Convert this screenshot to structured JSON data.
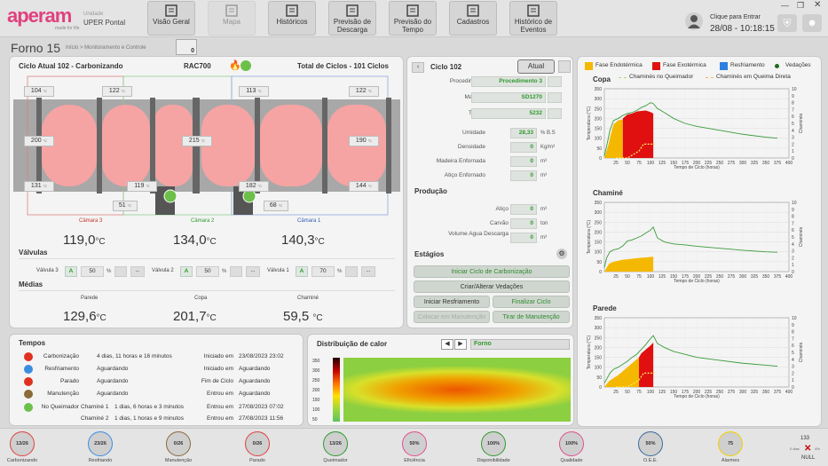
{
  "brand": {
    "logo": "aperam",
    "tagline": "made for life",
    "unit_label": "Unidade",
    "unit_name": "UPER Pontal"
  },
  "nav": [
    {
      "label": "Visão Geral",
      "icon": "grid-icon",
      "enabled": true
    },
    {
      "label": "Mapa",
      "icon": "map-icon",
      "enabled": false
    },
    {
      "label": "Históricos",
      "icon": "document-icon",
      "enabled": true
    },
    {
      "label": "Previsão de Descarga",
      "icon": "calendar-icon",
      "enabled": true
    },
    {
      "label": "Previsão do Tempo",
      "icon": "weather-icon",
      "enabled": true
    },
    {
      "label": "Cadastros",
      "icon": "register-icon",
      "enabled": true
    },
    {
      "label": "Histórico de Eventos",
      "icon": "document-icon",
      "enabled": true
    }
  ],
  "login": {
    "label": "Clique para Entrar",
    "datetime": "28/08 - 10:18:15"
  },
  "page": {
    "title": "Forno 15",
    "breadcrumb": "Início > Monitoramento e Controle",
    "alarm_count": "0"
  },
  "furnace": {
    "cycle_title": "Ciclo Atual 102 - Carbonizando",
    "rac": "RAC700",
    "total_cycles": "Total de Ciclos - 101 Ciclos",
    "temps_top": [
      "104",
      "122",
      "113",
      "122"
    ],
    "temps_mid": [
      "200",
      "215",
      "190"
    ],
    "temps_bottom": [
      "131",
      "119",
      "182",
      "144"
    ],
    "temps_lower": [
      "51",
      "68"
    ],
    "deg": "°C",
    "chambers": [
      {
        "name": "Câmara 3",
        "color": "#c0392b",
        "value": "119,0",
        "unit": "°C"
      },
      {
        "name": "Câmara 2",
        "color": "#2e9a2e",
        "value": "134,0",
        "unit": "°C"
      },
      {
        "name": "Câmara 1",
        "color": "#2f5fb5",
        "value": "140,3",
        "unit": "°C"
      }
    ],
    "valves_title": "Válvulas",
    "valves": [
      {
        "label": "Válvula 3",
        "mode": "A",
        "value": "50",
        "unit": "%",
        "dots": "..."
      },
      {
        "label": "Válvula 2",
        "mode": "A",
        "value": "50",
        "unit": "%",
        "dots": "..."
      },
      {
        "label": "Válvula 1",
        "mode": "A",
        "value": "70",
        "unit": "%",
        "dots": "..."
      }
    ],
    "medias_title": "Médias",
    "medias": [
      {
        "label": "Parede",
        "value": "129,6",
        "unit": "°C"
      },
      {
        "label": "Copa",
        "value": "201,7",
        "unit": "°C"
      },
      {
        "label": "Chaminé",
        "value": "59,5",
        "unit": "°C"
      }
    ]
  },
  "cycle": {
    "title": "Ciclo 102",
    "current_btn": "Atual",
    "fields": [
      {
        "label": "Procedimento",
        "value": "Procedimento 3",
        "unit": ""
      },
      {
        "label": "Madeira",
        "value": "SD1270",
        "unit": ""
      },
      {
        "label": "Talhão",
        "value": "5232",
        "unit": ""
      },
      {
        "label": "Umidade",
        "value": "28,33",
        "unit": "% B.S"
      },
      {
        "label": "Densidade",
        "value": "0",
        "unit": "Kg/m³"
      },
      {
        "label": "Madeira Enfornada",
        "value": "0",
        "unit": "m³"
      },
      {
        "label": "Atiço Enfornado",
        "value": "0",
        "unit": "m³"
      }
    ],
    "production_title": "Produção",
    "production": [
      {
        "label": "Atiço",
        "value": "0",
        "unit": "m³"
      },
      {
        "label": "Carvão",
        "value": "0",
        "unit": "ton"
      },
      {
        "label": "Volume Agua Descarga",
        "value": "0",
        "unit": "m³"
      }
    ],
    "stages_title": "Estágios",
    "stages": {
      "start": "Iniciar Ciclo de Carbonização",
      "seal": "Criar/Alterar Vedações",
      "cool": "Iniciar Resfriamento",
      "finish": "Finalizar Ciclo",
      "maint_off": "Colocar em Manutenção",
      "maint_on": "Tirar de Manutenção"
    }
  },
  "times": {
    "title": "Tempos",
    "rows": [
      {
        "icon": "flame-icon",
        "label": "Carbonização",
        "value": "4 dias, 11 horas e 16 minutos",
        "k": "Iniciado em",
        "v": "23/08/2023 23:02"
      },
      {
        "icon": "snowflake-icon",
        "label": "Resfriamento",
        "value": "Aguardando",
        "k": "Iniciado em",
        "v": "Aguardando"
      },
      {
        "icon": "stop-icon",
        "label": "Parado",
        "value": "Aguardando",
        "k": "Fim de Ciclo",
        "v": "Aguardando"
      },
      {
        "icon": "tools-icon",
        "label": "Manutenção",
        "value": "Aguardando",
        "k": "Entrou em",
        "v": "Aguardando"
      }
    ],
    "burner_label": "No Queimador",
    "burner": [
      {
        "label": "Chaminé 1",
        "value": "1 dias, 6 horas e 3 minutos",
        "k": "Entrou em",
        "v": "27/08/2023 07:02"
      },
      {
        "label": "Chaminé 2",
        "value": "1 dias, 1 horas e 9 minutos",
        "k": "Entrou em",
        "v": "27/08/2023 11:56"
      }
    ]
  },
  "heat": {
    "title": "Distribuição de calor",
    "selector": "Forno",
    "scale": [
      "350",
      "300",
      "250",
      "200",
      "150",
      "100",
      "50"
    ]
  },
  "legend": [
    {
      "label": "Fase Endotérmica",
      "color": "#f5b800"
    },
    {
      "label": "Fase Exotérmica",
      "color": "#e01010"
    },
    {
      "label": "Resfriamento",
      "color": "#2d7fe0"
    },
    {
      "label": "Vedações",
      "color": "#1f6b1f"
    },
    {
      "label": "Chaminés no Queimador",
      "color": "#a6e36b"
    },
    {
      "label": "Chaminés em Queima Direta",
      "color": "#f0b060"
    }
  ],
  "chart_data": [
    {
      "type": "area",
      "title": "Copa",
      "xlabel": "Tempo de Ciclo (horas)",
      "ylabel": "Temperatura (°C)",
      "y2label": "Chaminés",
      "xlim": [
        0,
        400
      ],
      "ylim": [
        0,
        350
      ],
      "y2lim": [
        0,
        10
      ],
      "xticks": [
        "25",
        "50",
        "75",
        "100",
        "125",
        "150",
        "175",
        "200",
        "225",
        "250",
        "275",
        "300",
        "325",
        "350",
        "375",
        "400"
      ],
      "yticks": [
        "0",
        "50",
        "100",
        "150",
        "200",
        "250",
        "300",
        "350"
      ],
      "y2ticks": [
        "0",
        "1",
        "2",
        "3",
        "4",
        "5",
        "6",
        "7",
        "8",
        "9",
        "10"
      ],
      "series": [
        {
          "name": "Temperatura",
          "x": [
            0,
            5,
            12,
            20,
            30,
            40,
            50,
            60,
            70,
            80,
            90,
            100,
            106,
            115,
            130,
            150,
            175,
            200,
            250,
            300,
            350,
            375
          ],
          "y": [
            10,
            60,
            140,
            190,
            200,
            215,
            225,
            230,
            240,
            255,
            265,
            280,
            275,
            250,
            230,
            200,
            175,
            160,
            140,
            120,
            105,
            100
          ]
        },
        {
          "name": "Fase Endotérmica",
          "x": [
            0,
            8,
            14,
            20,
            30,
            40
          ],
          "y": [
            0,
            60,
            120,
            170,
            190,
            195
          ]
        },
        {
          "name": "Fase Exotérmica",
          "x": [
            40,
            50,
            60,
            70,
            80,
            90,
            100,
            106
          ],
          "y": [
            200,
            220,
            225,
            235,
            238,
            240,
            232,
            225
          ]
        },
        {
          "name": "Chaminés no Queimador",
          "x": [
            25,
            50,
            75,
            85,
            100,
            110
          ],
          "y": [
            0,
            0,
            1,
            2,
            2,
            2
          ]
        }
      ]
    },
    {
      "type": "area",
      "title": "Chaminé",
      "xlabel": "Tempo de Ciclo (horas)",
      "ylabel": "Temperatura (°C)",
      "y2label": "Chaminés",
      "xlim": [
        0,
        400
      ],
      "ylim": [
        0,
        350
      ],
      "y2lim": [
        0,
        10
      ],
      "xticks": [
        "25",
        "50",
        "75",
        "100",
        "125",
        "150",
        "175",
        "200",
        "225",
        "250",
        "275",
        "300",
        "325",
        "350",
        "375",
        "400"
      ],
      "yticks": [
        "0",
        "50",
        "100",
        "150",
        "200",
        "250",
        "300",
        "350"
      ],
      "y2ticks": [
        "0",
        "1",
        "2",
        "3",
        "4",
        "5",
        "6",
        "7",
        "8",
        "9",
        "10"
      ],
      "series": [
        {
          "name": "Temperatura",
          "x": [
            0,
            5,
            12,
            20,
            30,
            40,
            50,
            60,
            70,
            80,
            90,
            100,
            106,
            115,
            130,
            150,
            175,
            200,
            250,
            300,
            350,
            375
          ],
          "y": [
            20,
            70,
            100,
            110,
            115,
            130,
            155,
            160,
            170,
            180,
            195,
            210,
            225,
            170,
            150,
            140,
            135,
            128,
            118,
            108,
            100,
            98
          ]
        },
        {
          "name": "Fase Endotérmica",
          "x": [
            0,
            10,
            20,
            30,
            40,
            50,
            60,
            70,
            80,
            90,
            100,
            106
          ],
          "y": [
            0,
            40,
            50,
            55,
            60,
            62,
            65,
            68,
            70,
            72,
            74,
            75
          ]
        }
      ]
    },
    {
      "type": "area",
      "title": "Parede",
      "xlabel": "Tempo de Ciclo (horas)",
      "ylabel": "Temperatura (°C)",
      "y2label": "Chaminés",
      "xlim": [
        0,
        400
      ],
      "ylim": [
        0,
        350
      ],
      "y2lim": [
        0,
        10
      ],
      "xticks": [
        "25",
        "50",
        "75",
        "100",
        "125",
        "150",
        "175",
        "200",
        "225",
        "250",
        "275",
        "300",
        "325",
        "350",
        "375",
        "400"
      ],
      "yticks": [
        "0",
        "50",
        "100",
        "150",
        "200",
        "250",
        "300",
        "350"
      ],
      "y2ticks": [
        "0",
        "1",
        "2",
        "3",
        "4",
        "5",
        "6",
        "7",
        "8",
        "9",
        "10"
      ],
      "series": [
        {
          "name": "Temperatura",
          "x": [
            0,
            5,
            12,
            20,
            30,
            40,
            50,
            60,
            70,
            80,
            90,
            100,
            106,
            115,
            130,
            150,
            175,
            200,
            250,
            300,
            350,
            375
          ],
          "y": [
            20,
            40,
            70,
            90,
            100,
            115,
            130,
            150,
            165,
            190,
            215,
            245,
            260,
            220,
            200,
            180,
            165,
            150,
            135,
            120,
            110,
            105
          ]
        },
        {
          "name": "Fase Endotérmica",
          "x": [
            0,
            10,
            20,
            30,
            40,
            50,
            60,
            70,
            75
          ],
          "y": [
            0,
            30,
            45,
            60,
            80,
            100,
            120,
            140,
            150
          ]
        },
        {
          "name": "Fase Exotérmica",
          "x": [
            75,
            80,
            90,
            100,
            106
          ],
          "y": [
            150,
            170,
            190,
            210,
            225
          ]
        },
        {
          "name": "Chaminés no Queimador",
          "x": [
            25,
            50,
            75,
            85,
            100,
            110
          ],
          "y": [
            0,
            0,
            1,
            2,
            2,
            2
          ]
        }
      ]
    }
  ],
  "kpis": [
    {
      "label": "Carbonizando",
      "value": "13/26",
      "color": "#e04040"
    },
    {
      "label": "Resfriando",
      "value": "23/26",
      "color": "#3a8de0"
    },
    {
      "label": "Manutenção",
      "value": "0/26",
      "color": "#8a6a3a"
    },
    {
      "label": "Parado",
      "value": "0/26",
      "color": "#e04040"
    },
    {
      "label": "Queimador",
      "value": "13/26",
      "color": "#2e9a2e"
    },
    {
      "label": "Eficiência",
      "value": "50%",
      "color": "#e05090"
    },
    {
      "label": "Disponibilidade",
      "value": "100%",
      "color": "#2e9a2e"
    },
    {
      "label": "Qualidade",
      "value": "100%",
      "color": "#e05090"
    },
    {
      "label": "O.E.E.",
      "value": "50%",
      "color": "#3a6a9a"
    },
    {
      "label": "Alarmes",
      "value": "75",
      "color": "#f0d000"
    }
  ],
  "footer": {
    "count": "133",
    "status": "NULL",
    "small1": "0 dias",
    "small2": "4%"
  }
}
